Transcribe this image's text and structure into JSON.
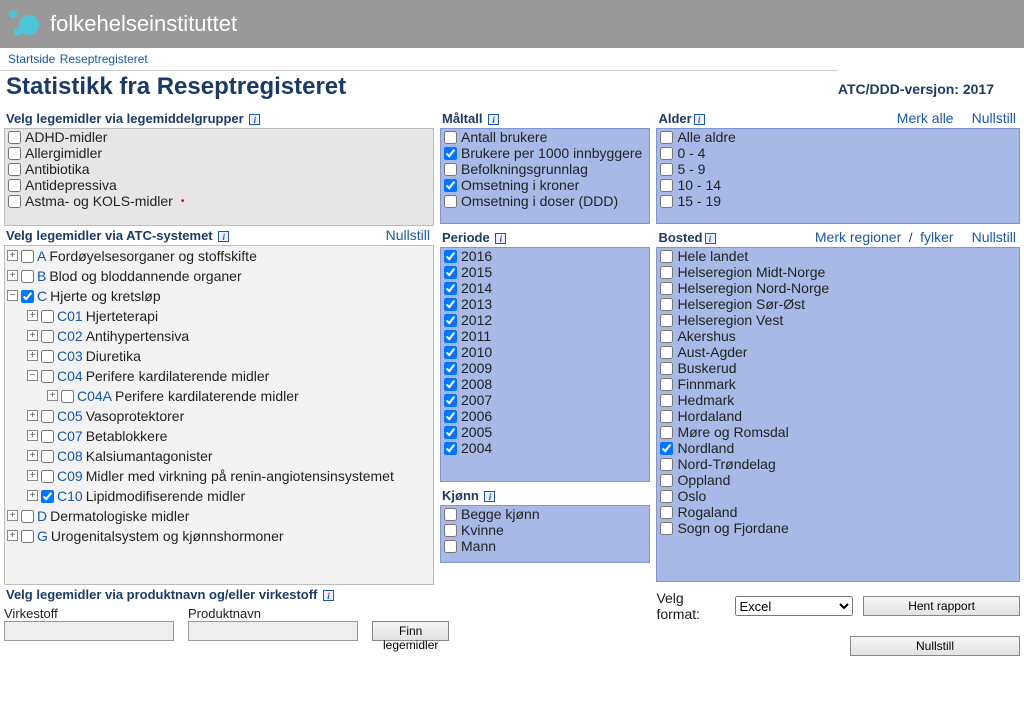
{
  "header": {
    "brand": "folkehelseinstituttet"
  },
  "breadcrumb": {
    "startside": "Startside",
    "resept": "Reseptregisteret"
  },
  "title": "Statistikk fra Reseptregisteret",
  "version": "ATC/DDD-versjon: 2017",
  "labels": {
    "velg_grupper": "Velg legemidler via legemiddelgrupper",
    "velg_atc": "Velg legemidler via ATC-systemet",
    "velg_produkt": "Velg legemidler via produktnavn og/eller virkestoff",
    "maltall": "Måltall",
    "periode": "Periode",
    "kjonn": "Kjønn",
    "alder": "Alder",
    "bosted": "Bosted",
    "nullstill": "Nullstill",
    "merk_alle": "Merk alle",
    "merk_regioner": "Merk regioner",
    "fylker": "fylker",
    "virkestoff": "Virkestoff",
    "produktnavn": "Produktnavn",
    "finn": "Finn legemidler",
    "velg_format": "Velg format:",
    "hent": "Hent rapport"
  },
  "grupper": [
    "ADHD-midler",
    "Allergimidler",
    "Antibiotika",
    "Antidepressiva",
    "Astma- og KOLS-midler"
  ],
  "atc": {
    "A": {
      "code": "A",
      "label": "Fordøyelsesorganer og stoffskifte",
      "open": false,
      "checked": false
    },
    "B": {
      "code": "B",
      "label": "Blod og bloddannende organer",
      "open": false,
      "checked": false
    },
    "C": {
      "code": "C",
      "label": "Hjerte og kretsløp",
      "open": true,
      "checked": true,
      "children": [
        {
          "code": "C01",
          "label": "Hjerteterapi",
          "open": false
        },
        {
          "code": "C02",
          "label": "Antihypertensiva",
          "open": false
        },
        {
          "code": "C03",
          "label": "Diuretika",
          "open": false
        },
        {
          "code": "C04",
          "label": "Perifere kardilaterende midler",
          "open": true,
          "children": [
            {
              "code": "C04A",
              "label": "Perifere kardilaterende midler",
              "open": false
            }
          ]
        },
        {
          "code": "C05",
          "label": "Vasoprotektorer",
          "open": false
        },
        {
          "code": "C07",
          "label": "Betablokkere",
          "open": false
        },
        {
          "code": "C08",
          "label": "Kalsiumantagonister",
          "open": false
        },
        {
          "code": "C09",
          "label": "Midler med virkning på renin-angiotensinsystemet",
          "open": false
        },
        {
          "code": "C10",
          "label": "Lipidmodifiserende midler",
          "open": false,
          "checked": true
        }
      ]
    },
    "D": {
      "code": "D",
      "label": "Dermatologiske midler",
      "open": false,
      "checked": false
    },
    "G": {
      "code": "G",
      "label": "Urogenitalsystem og kjønnshormoner",
      "open": false,
      "checked": false
    }
  },
  "maltall": [
    {
      "label": "Antall brukere",
      "checked": false
    },
    {
      "label": "Brukere per 1000 innbyggere",
      "checked": true
    },
    {
      "label": "Befolkningsgrunnlag",
      "checked": false
    },
    {
      "label": "Omsetning i kroner",
      "checked": true
    },
    {
      "label": "Omsetning i doser (DDD)",
      "checked": false
    }
  ],
  "periode": [
    {
      "label": "2016",
      "checked": true
    },
    {
      "label": "2015",
      "checked": true
    },
    {
      "label": "2014",
      "checked": true
    },
    {
      "label": "2013",
      "checked": true
    },
    {
      "label": "2012",
      "checked": true
    },
    {
      "label": "2011",
      "checked": true
    },
    {
      "label": "2010",
      "checked": true
    },
    {
      "label": "2009",
      "checked": true
    },
    {
      "label": "2008",
      "checked": true
    },
    {
      "label": "2007",
      "checked": true
    },
    {
      "label": "2006",
      "checked": true
    },
    {
      "label": "2005",
      "checked": true
    },
    {
      "label": "2004",
      "checked": true
    }
  ],
  "kjonn": [
    {
      "label": "Begge kjønn",
      "checked": false
    },
    {
      "label": "Kvinne",
      "checked": false
    },
    {
      "label": "Mann",
      "checked": false
    }
  ],
  "alder": [
    {
      "label": "Alle aldre",
      "checked": false
    },
    {
      "label": "0 - 4",
      "checked": false
    },
    {
      "label": "5 - 9",
      "checked": false
    },
    {
      "label": "10 - 14",
      "checked": false
    },
    {
      "label": "15 - 19",
      "checked": false
    }
  ],
  "bosted": [
    {
      "label": "Hele landet",
      "checked": false
    },
    {
      "label": "Helseregion Midt-Norge",
      "checked": false
    },
    {
      "label": "Helseregion Nord-Norge",
      "checked": false
    },
    {
      "label": "Helseregion Sør-Øst",
      "checked": false
    },
    {
      "label": "Helseregion Vest",
      "checked": false
    },
    {
      "label": "Akershus",
      "checked": false
    },
    {
      "label": "Aust-Agder",
      "checked": false
    },
    {
      "label": "Buskerud",
      "checked": false
    },
    {
      "label": "Finnmark",
      "checked": false
    },
    {
      "label": "Hedmark",
      "checked": false
    },
    {
      "label": "Hordaland",
      "checked": false
    },
    {
      "label": "Møre og Romsdal",
      "checked": false
    },
    {
      "label": "Nordland",
      "checked": true
    },
    {
      "label": "Nord-Trøndelag",
      "checked": false
    },
    {
      "label": "Oppland",
      "checked": false
    },
    {
      "label": "Oslo",
      "checked": false
    },
    {
      "label": "Rogaland",
      "checked": false
    },
    {
      "label": "Sogn og Fjordane",
      "checked": false
    }
  ],
  "format": {
    "selected": "Excel",
    "options": [
      "Excel"
    ]
  }
}
